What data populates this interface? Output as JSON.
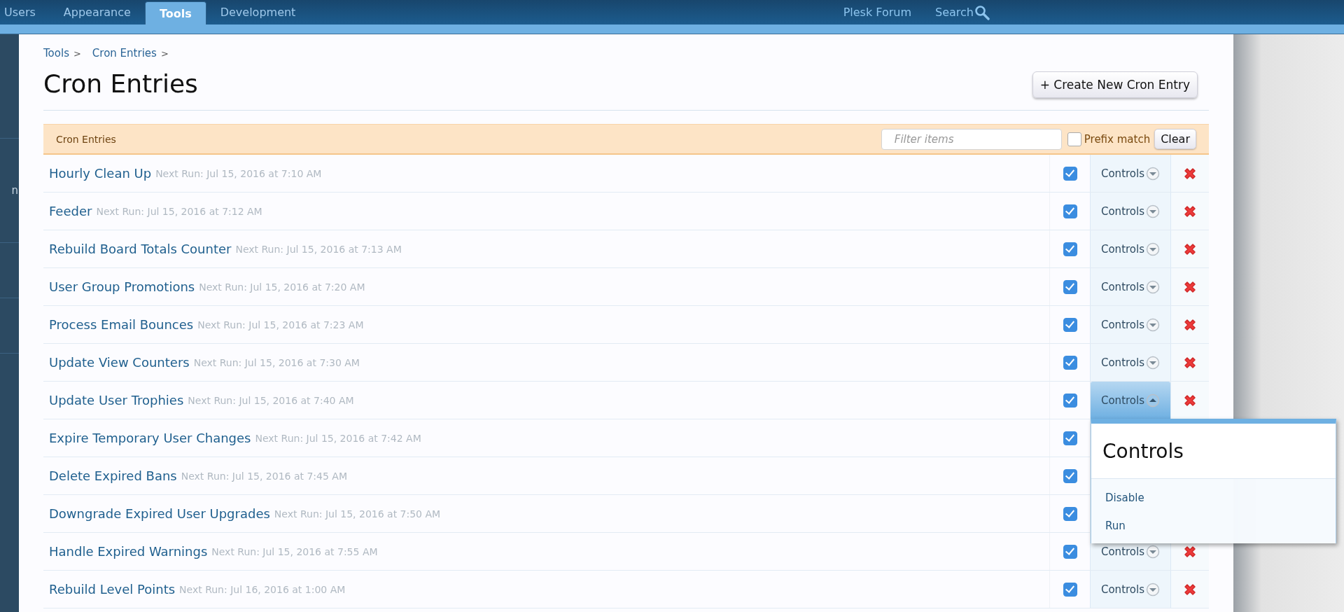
{
  "nav": {
    "tabs": [
      {
        "label": "Users",
        "selected": false
      },
      {
        "label": "Appearance",
        "selected": false
      },
      {
        "label": "Tools",
        "selected": true
      },
      {
        "label": "Development",
        "selected": false
      }
    ],
    "links": [
      {
        "label": "Plesk Forum",
        "kind": "link"
      },
      {
        "label": "Search",
        "kind": "search"
      }
    ]
  },
  "sidebar": {
    "items": [
      {
        "label": "n"
      }
    ]
  },
  "breadcrumb": [
    "Tools",
    "Cron Entries"
  ],
  "breadcrumb_separator": ">",
  "title": "Cron Entries",
  "create_button": "+ Create New Cron Entry",
  "list": {
    "title": "Cron Entries",
    "filter": {
      "placeholder": "Filter items"
    },
    "prefix_match": {
      "label": "Prefix match",
      "checked": false
    },
    "clear_button": "Clear",
    "rows": [
      {
        "title": "Hourly Clean Up",
        "next_run": "Next Run: Jul 15, 2016 at 7:10 AM",
        "enabled": true,
        "controls_label": "Controls",
        "expanded": false
      },
      {
        "title": "Feeder",
        "next_run": "Next Run: Jul 15, 2016 at 7:12 AM",
        "enabled": true,
        "controls_label": "Controls",
        "expanded": false
      },
      {
        "title": "Rebuild Board Totals Counter",
        "next_run": "Next Run: Jul 15, 2016 at 7:13 AM",
        "enabled": true,
        "controls_label": "Controls",
        "expanded": false
      },
      {
        "title": "User Group Promotions",
        "next_run": "Next Run: Jul 15, 2016 at 7:20 AM",
        "enabled": true,
        "controls_label": "Controls",
        "expanded": false
      },
      {
        "title": "Process Email Bounces",
        "next_run": "Next Run: Jul 15, 2016 at 7:23 AM",
        "enabled": true,
        "controls_label": "Controls",
        "expanded": false
      },
      {
        "title": "Update View Counters",
        "next_run": "Next Run: Jul 15, 2016 at 7:30 AM",
        "enabled": true,
        "controls_label": "Controls",
        "expanded": false
      },
      {
        "title": "Update User Trophies",
        "next_run": "Next Run: Jul 15, 2016 at 7:40 AM",
        "enabled": true,
        "controls_label": "Controls",
        "expanded": true,
        "menu": {
          "title": "Controls",
          "items": [
            "Disable",
            "Run"
          ]
        }
      },
      {
        "title": "Expire Temporary User Changes",
        "next_run": "Next Run: Jul 15, 2016 at 7:42 AM",
        "enabled": true
      },
      {
        "title": "Delete Expired Bans",
        "next_run": "Next Run: Jul 15, 2016 at 7:45 AM",
        "enabled": true
      },
      {
        "title": "Downgrade Expired User Upgrades",
        "next_run": "Next Run: Jul 15, 2016 at 7:50 AM",
        "enabled": true
      },
      {
        "title": "Handle Expired Warnings",
        "next_run": "Next Run: Jul 15, 2016 at 7:55 AM",
        "enabled": true,
        "controls_label": "Controls",
        "expanded": false
      },
      {
        "title": "Rebuild Level Points",
        "next_run": "Next Run: Jul 16, 2016 at 1:00 AM",
        "enabled": true,
        "controls_label": "Controls",
        "expanded": false
      }
    ]
  }
}
